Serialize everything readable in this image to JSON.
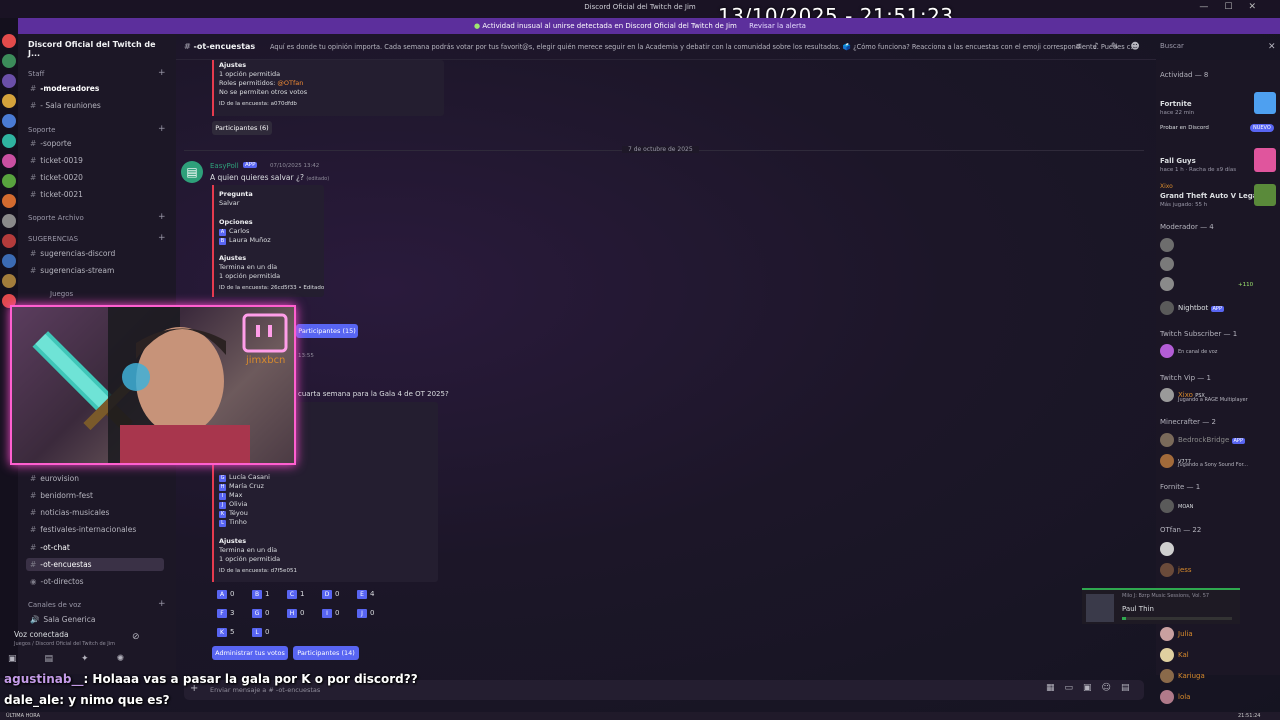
{
  "window": {
    "title": "Discord Oficial del Twitch de Jim",
    "controls": [
      "—",
      "☐",
      "✕"
    ]
  },
  "overlay_timestamp": "13/10/2025 - 21:51:23",
  "banner": {
    "text": "Actividad inusual al unirse detectada en Discord Oficial del Twitch de Jim",
    "action": "Revisar la alerta"
  },
  "server": {
    "name": "Discord Oficial del Twitch de J..."
  },
  "sidebar": {
    "categories": {
      "staff": "Staff",
      "soporte": "Soporte",
      "soporte_archivo": "Soporte Archivo",
      "sugerencias": "SUGERENCIAS",
      "juegos": "Juegos",
      "canales_voz": "Canales de voz"
    },
    "channels": {
      "moderadores": "-moderadores",
      "sala_reuniones": "- Sala reuniones",
      "soporte": "-soporte",
      "ticket_0019": "ticket-0019",
      "ticket_0020": "ticket-0020",
      "ticket_0021": "ticket-0021",
      "sug_discord": "sugerencias-discord",
      "sug_stream": "sugerencias-stream",
      "eurovision": "eurovision",
      "benidorm": "benidorm-fest",
      "noticias": "noticias-musicales",
      "festivales": "festivales-internacionales",
      "ot_chat": "-ot-chat",
      "ot_encuestas": "-ot-encuestas",
      "ot_directos": "-ot-directos",
      "sala_generica": "Sala Generica"
    },
    "voice": {
      "status": "Voz conectada",
      "location": "Juegos / Discord Oficial del Twitch de Jim"
    }
  },
  "header": {
    "channel": "-ot-encuestas",
    "topic": "Aquí es donde tu opinión importa. Cada semana podrás votar por tus favorit@s, elegir quién merece seguir en la Academia y debatir con la comunidad sobre los resultados. 🗳️ ¿Cómo funciona? Reacciona a las encuestas con el emoji correspondiente. Puedes c...",
    "search_placeholder": "Buscar"
  },
  "messages": {
    "poll1": {
      "ajustes_label": "Ajustes",
      "ajuste1": "1 opción permitida",
      "ajuste2": "Roles permitidos:",
      "role": "@OTfan",
      "ajuste3": "No se permiten otros votos",
      "poll_id": "ID de la encuesta: a070dfdb",
      "participants": "Participantes (6)"
    },
    "date_divider": "7 de octubre de 2025",
    "poll2": {
      "author": "EasyPoll",
      "app_badge": "APP",
      "timestamp": "07/10/2025 13:42",
      "question": "A quien quieres salvar ¿?",
      "edited": "(editado)",
      "pregunta_label": "Pregunta",
      "pregunta_value": "Salvar",
      "opciones_label": "Opciones",
      "options": [
        {
          "letter": "A",
          "name": "Carlos"
        },
        {
          "letter": "B",
          "name": "Laura Muñoz"
        }
      ],
      "ajustes_label": "Ajustes",
      "ajuste1": "Termina en un día",
      "ajuste2": "1 opción permitida",
      "poll_id": "ID de la encuesta: 26cd5f33 • Editado",
      "participants": "Participantes (15)"
    },
    "poll3": {
      "timestamp_frag": "13:55",
      "question_frag": "cuarta semana para la Gala 4 de OT 2025?",
      "options": [
        {
          "letter": "G",
          "name": "Lucía Casani"
        },
        {
          "letter": "H",
          "name": "María Cruz"
        },
        {
          "letter": "I",
          "name": "Max"
        },
        {
          "letter": "J",
          "name": "Olivia"
        },
        {
          "letter": "K",
          "name": "Téyou"
        },
        {
          "letter": "L",
          "name": "Tinho"
        }
      ],
      "ajustes_label": "Ajustes",
      "ajuste1": "Termina en un día",
      "ajuste2": "1 opción permitida",
      "poll_id": "ID de la encuesta: d7f5e051",
      "votes": [
        {
          "letter": "A",
          "count": "0"
        },
        {
          "letter": "B",
          "count": "1"
        },
        {
          "letter": "C",
          "count": "1"
        },
        {
          "letter": "D",
          "count": "0"
        },
        {
          "letter": "E",
          "count": "4"
        },
        {
          "letter": "F",
          "count": "3"
        },
        {
          "letter": "G",
          "count": "0"
        },
        {
          "letter": "H",
          "count": "0"
        },
        {
          "letter": "I",
          "count": "0"
        },
        {
          "letter": "J",
          "count": "0"
        },
        {
          "letter": "K",
          "count": "5"
        },
        {
          "letter": "L",
          "count": "0"
        }
      ],
      "manage_button": "Administrar tus votos",
      "participants": "Participantes (14)"
    }
  },
  "composer": {
    "placeholder": "Enviar mensaje a # -ot-encuestas"
  },
  "webcam": {
    "brand": "jimxbcn"
  },
  "right_panel": {
    "activity_header": "Actividad — 8",
    "activities": [
      {
        "game": "Fortnite",
        "detail": "hace 22 min"
      },
      {
        "game": "Fall Guys",
        "detail": "hace 1 h · Racha de x9 días"
      },
      {
        "game": "Grand Theft Auto V Legacy",
        "detail": "Más jugado: 55 h"
      }
    ],
    "probar": "Probar en Discord",
    "nuevo": "NUEVO",
    "xixo_name": "Xixo",
    "groups": {
      "moderador": "Moderador — 4",
      "twitch_sub": "Twitch Subscriber — 1",
      "twitch_vip": "Twitch Vip — 1",
      "minecrafter": "Minecrafter — 2",
      "fornite": "Fornite — 1",
      "otfan": "OTfan — 22"
    },
    "members": {
      "nightbot": "Nightbot",
      "app": "APP",
      "sub_status": "En canal de voz",
      "xixo": "Xixo",
      "xixo_badge": "PSX",
      "xixo_status": "Jugando a RAGE Multiplayer",
      "bedrock": "BedrockBridge",
      "m_status": "Jugando a Sony Sound For...",
      "m_badge": "V777",
      "moan": "MOAN",
      "plus110": "+110",
      "jess": "jess",
      "julia": "Julia",
      "kal": "Kal",
      "kariuga": "Kariuga",
      "lola": "lola"
    }
  },
  "music": {
    "album": "Milo J: Bzrp Music Sessions, Vol. 57",
    "artist": "Paul Thin"
  },
  "chat_overlay": [
    {
      "user": "agustinab__",
      "msg": ": Holaaa vas a pasar la gala por K o por discord??"
    },
    {
      "user": "dale_ale",
      "msg": ": y nimo que es?"
    }
  ],
  "taskbar": {
    "left_label": "ÚLTIMA HORA",
    "time": "21:51:24"
  },
  "colors": {
    "accent": "#5865f2",
    "poll_bar": "#e53b4e",
    "banner": "#5c2f9c",
    "webcam_border": "#ff5fd0",
    "role": "#f08a34"
  }
}
